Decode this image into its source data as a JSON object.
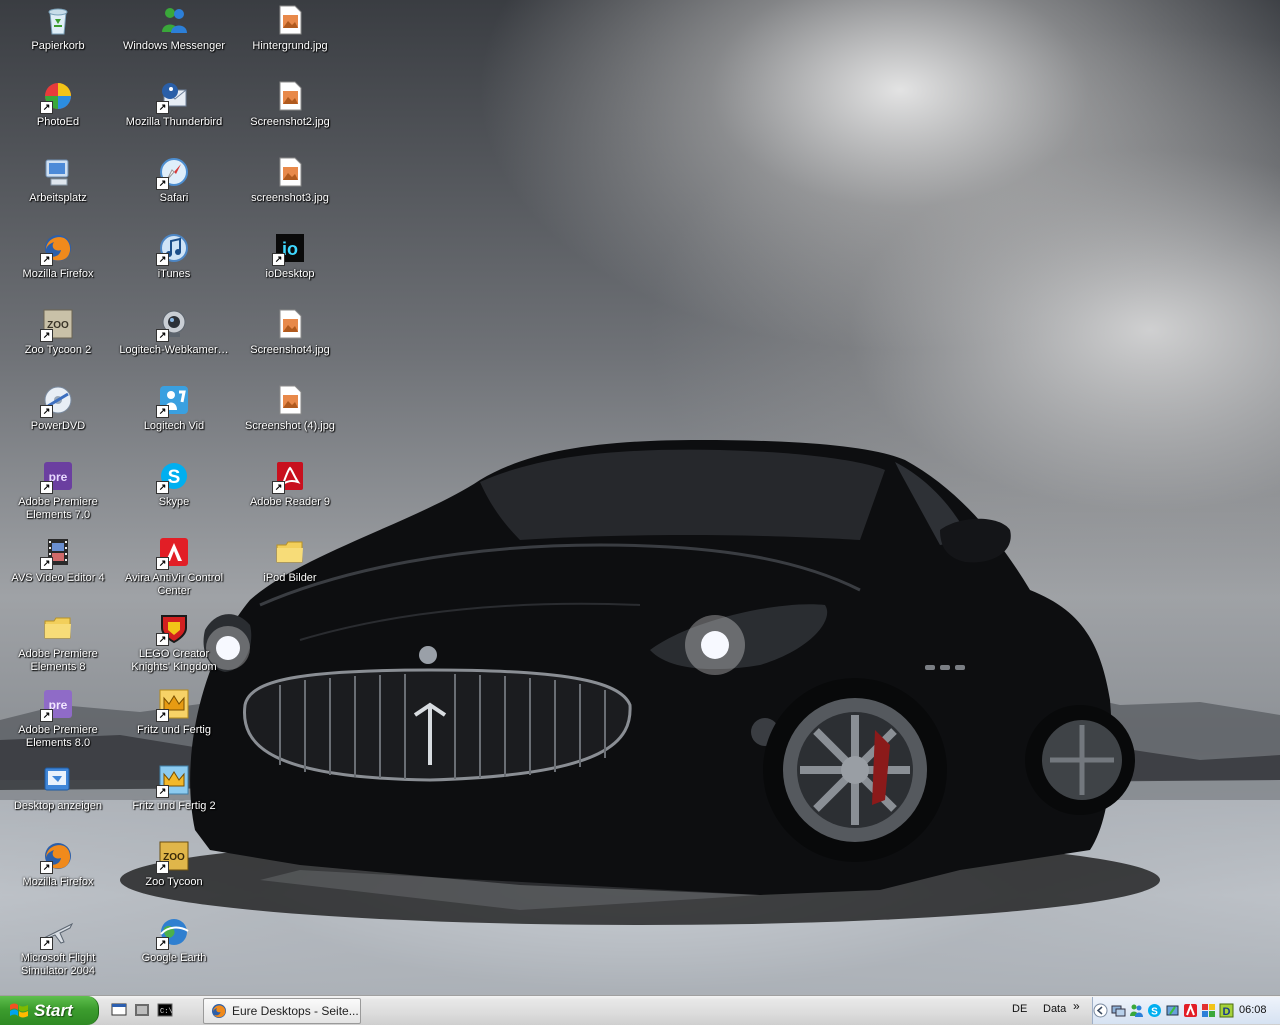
{
  "desktop": {
    "icons": [
      {
        "label": "Papierkorb",
        "icon": "recycle-bin-icon"
      },
      {
        "label": "PhotoEd",
        "icon": "photoed-icon"
      },
      {
        "label": "Arbeitsplatz",
        "icon": "my-computer-icon"
      },
      {
        "label": "Mozilla Firefox",
        "icon": "firefox-icon"
      },
      {
        "label": "Zoo Tycoon 2",
        "icon": "zoo-tycoon-icon"
      },
      {
        "label": "PowerDVD",
        "icon": "powerdvd-icon"
      },
      {
        "label": "Adobe Premiere Elements 7.0",
        "icon": "premiere-icon"
      },
      {
        "label": "AVS Video Editor 4",
        "icon": "film-icon"
      },
      {
        "label": "Adobe Premiere Elements 8",
        "icon": "folder-icon"
      },
      {
        "label": "Adobe Premiere Elements 8.0",
        "icon": "premiere-icon"
      },
      {
        "label": "Desktop anzeigen",
        "icon": "show-desktop-icon"
      },
      {
        "label": "Mozilla Firefox",
        "icon": "firefox-icon"
      },
      {
        "label": "Microsoft Flight Simulator 2004",
        "icon": "airplane-icon"
      },
      {
        "label": "Windows Messenger",
        "icon": "messenger-icon"
      },
      {
        "label": "Mozilla Thunderbird",
        "icon": "thunderbird-icon"
      },
      {
        "label": "Safari",
        "icon": "safari-icon"
      },
      {
        "label": "iTunes",
        "icon": "itunes-icon"
      },
      {
        "label": "Logitech-Webkamer…",
        "icon": "webcam-icon"
      },
      {
        "label": "Logitech Vid",
        "icon": "logitech-vid-icon"
      },
      {
        "label": "Skype",
        "icon": "skype-icon"
      },
      {
        "label": "Avira AntiVir Control Center",
        "icon": "avira-icon"
      },
      {
        "label": "LEGO Creator Knights' Kingdom",
        "icon": "lego-shield-icon"
      },
      {
        "label": "Fritz und Fertig",
        "icon": "crown-icon"
      },
      {
        "label": "Fritz und Fertig 2",
        "icon": "crown-icon"
      },
      {
        "label": "Zoo Tycoon",
        "icon": "zoo-tycoon-icon"
      },
      {
        "label": "Google Earth",
        "icon": "google-earth-icon"
      },
      {
        "label": "Hintergrund.jpg",
        "icon": "image-file-icon"
      },
      {
        "label": "Screenshot2.jpg",
        "icon": "image-file-icon"
      },
      {
        "label": "screenshot3.jpg",
        "icon": "image-file-icon"
      },
      {
        "label": "ioDesktop",
        "icon": "iodesktop-icon"
      },
      {
        "label": "Screenshot4.jpg",
        "icon": "image-file-icon"
      },
      {
        "label": "Screenshot (4).jpg",
        "icon": "image-file-icon"
      },
      {
        "label": "Adobe Reader 9",
        "icon": "adobe-reader-icon"
      },
      {
        "label": "iPod Bilder",
        "icon": "folder-icon"
      }
    ]
  },
  "taskbar": {
    "start_label": "Start",
    "quick_launch": [
      "show-desktop-icon",
      "media-icon",
      "cmd-icon"
    ],
    "window_button_label": "Eure Desktops - Seite...",
    "language": "DE",
    "toolbar_label": "Data",
    "toolbar_chevron": "»",
    "tray_icons": [
      "tray-collapse-icon",
      "network-icon",
      "messenger-tray-icon",
      "skype-tray-icon",
      "safely-remove-icon",
      "avira-tray-icon",
      "lego-tray-icon",
      "d-tray-icon"
    ],
    "clock": "06:08"
  },
  "colors": {
    "start_green": "#3c9d2e",
    "taskbar_silver": "#dcdcdc",
    "tray_blue": "#d6e2f2"
  }
}
